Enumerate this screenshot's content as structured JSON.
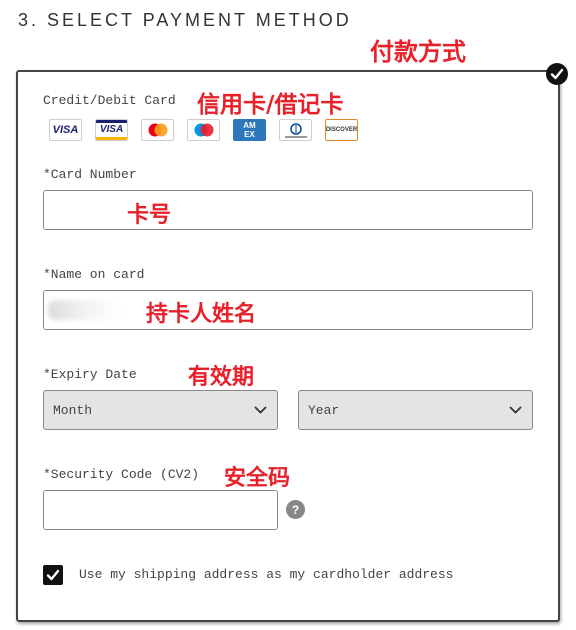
{
  "section": {
    "title": "3. SELECT PAYMENT METHOD"
  },
  "annotations": {
    "payment_method": "付款方式",
    "card_type": "信用卡/借记卡",
    "card_number": "卡号",
    "cardholder_name": "持卡人姓名",
    "expiry": "有效期",
    "security_code": "安全码"
  },
  "colors": {
    "annotation": "#e8202a",
    "panel_border": "#444444",
    "select_bg": "#e4e4e4"
  },
  "payment": {
    "option_label": "Credit/Debit Card",
    "selected": true,
    "card_logos": [
      {
        "name": "visa-logo",
        "text": "VISA"
      },
      {
        "name": "visa-electron-logo",
        "text": "VISA"
      },
      {
        "name": "mastercard-logo",
        "text": ""
      },
      {
        "name": "maestro-logo",
        "text": ""
      },
      {
        "name": "amex-logo",
        "text": "AM EX"
      },
      {
        "name": "diners-club-logo",
        "text": ""
      },
      {
        "name": "discover-logo",
        "text": "DISCOVER"
      }
    ]
  },
  "fields": {
    "card_number": {
      "label": "*Card Number",
      "value": ""
    },
    "name_on_card": {
      "label": "*Name on card",
      "value": ""
    },
    "expiry": {
      "label": "*Expiry Date",
      "month": "Month",
      "year": "Year"
    },
    "security_code": {
      "label": "*Security Code (CV2)",
      "value": "",
      "help": "?"
    }
  },
  "shipping_as_billing": {
    "checked": true,
    "label": "Use my shipping address as my cardholder address"
  }
}
